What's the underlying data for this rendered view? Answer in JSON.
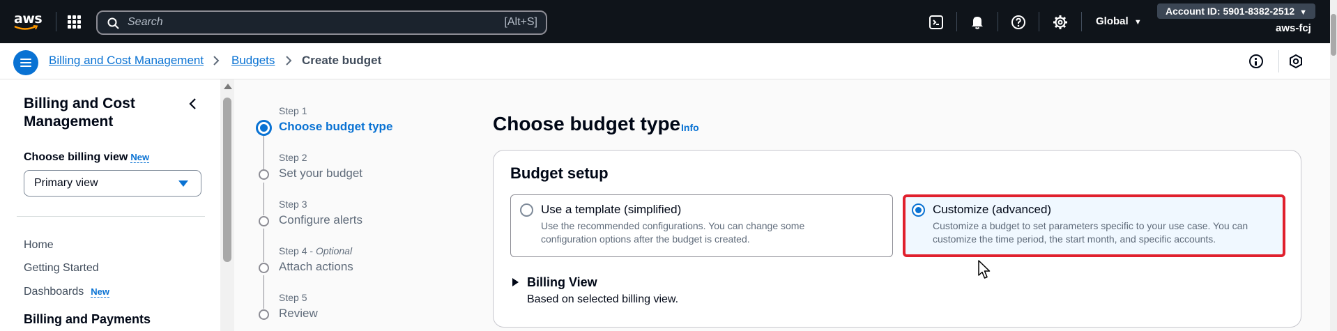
{
  "topnav": {
    "logo_text": "aws",
    "search_placeholder": "Search",
    "search_shortcut": "[Alt+S]",
    "icons": [
      "cloudshell-icon",
      "bell-icon",
      "help-icon",
      "gear-icon"
    ],
    "region": "Global",
    "account_id": "Account ID: 5901-8382-2512",
    "user": "aws-fcj"
  },
  "breadcrumb": {
    "items": [
      {
        "label": "Billing and Cost Management",
        "link": true
      },
      {
        "label": "Budgets",
        "link": true
      },
      {
        "label": "Create budget",
        "link": false
      }
    ]
  },
  "sidebar": {
    "title": "Billing and Cost Management",
    "billing_view_label": "Choose billing view",
    "new_badge": "New",
    "billing_view_value": "Primary view",
    "items": [
      {
        "label": "Home"
      },
      {
        "label": "Getting Started"
      },
      {
        "label": "Dashboards",
        "badge": "New"
      }
    ],
    "section": "Billing and Payments"
  },
  "wizard": {
    "steps": [
      {
        "label": "Step 1",
        "title": "Choose budget type",
        "active": true
      },
      {
        "label": "Step 2",
        "title": "Set your budget",
        "active": false
      },
      {
        "label": "Step 3",
        "title": "Configure alerts",
        "active": false
      },
      {
        "label": "Step 4",
        "optional": "Optional",
        "title": "Attach actions",
        "active": false
      },
      {
        "label": "Step 5",
        "title": "Review",
        "active": false
      }
    ]
  },
  "main": {
    "title": "Choose budget type",
    "info": "Info",
    "panel_title": "Budget setup",
    "options": [
      {
        "title": "Use a template (simplified)",
        "desc1": "Use the recommended configurations. You can change some",
        "desc2": "configuration options after the budget is created.",
        "selected": false
      },
      {
        "title": "Customize (advanced)",
        "desc1": "Customize a budget to set parameters specific to your use case. You can",
        "desc2": "customize the time period, the start month, and specific accounts.",
        "selected": true
      }
    ],
    "billing_view_title": "Billing View",
    "billing_view_desc": "Based on selected billing view."
  },
  "colors": {
    "nav_bg": "#0f141a",
    "accent": "#0972d3",
    "highlight": "#e0202d"
  }
}
